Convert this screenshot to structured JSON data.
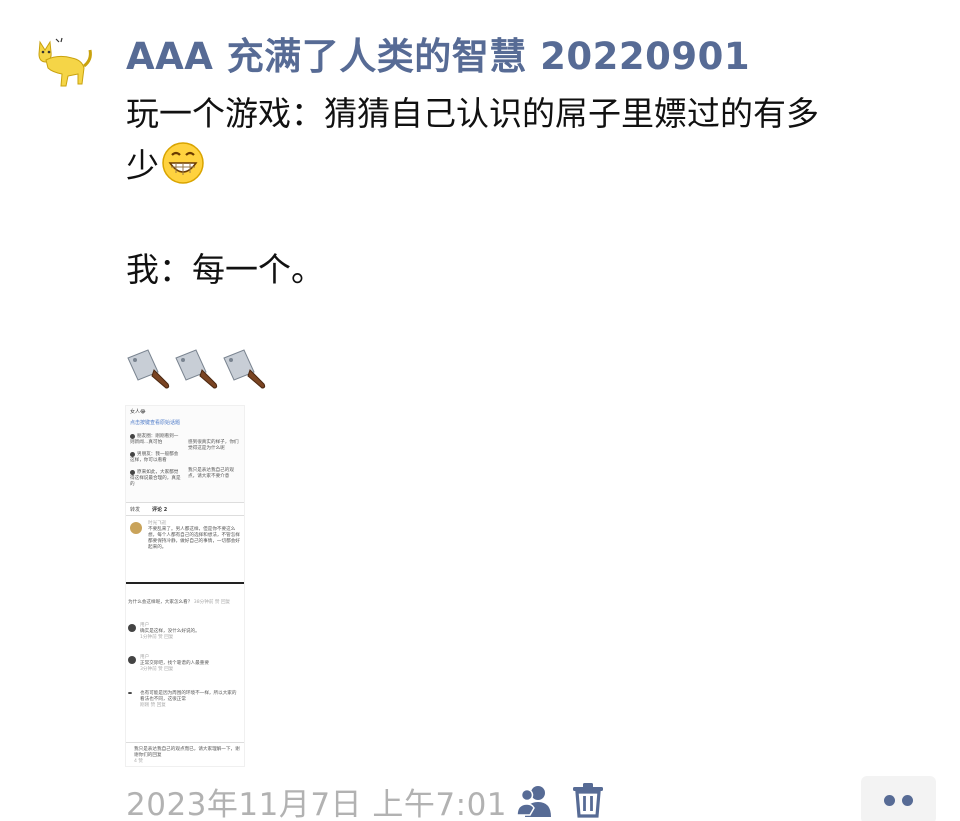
{
  "post": {
    "author": "AAA 充满了人类的智慧 20220901",
    "lines": [
      "玩一个游戏：猜猜自己认识的屌子里嫖过的有多",
      "少",
      "我：每一个。"
    ],
    "emoji_icons": [
      "grinning-face-icon",
      "cleaver-icon",
      "cleaver-icon",
      "cleaver-icon"
    ]
  },
  "thumbnail": {
    "head_title": "女人😂",
    "head_link": "点击按键查看原始话题",
    "bubble_left_1": "朋友圈：刚刚看到一则新闻…真可怕",
    "bubble_left_2": "男朋友：我一般都会这样，你可以看看",
    "bubble_left_3": "原来如此，大家都觉得这样说最合理的，真是的",
    "bubble_right_1": "感到很真实的样子，你们觉得这是为什么呢",
    "bubble_right_2": "我只是表达我自己的观点，请大家不要介意",
    "tab_1": "转发",
    "tab_2": "评论 2",
    "comment_name": "时光飞逝",
    "comment_text": "不要乱来了。男人都这样，但是你不要这么想，每个人都有自己的选择和想法，不管怎样都要保持冷静，做好自己的事情，一切都会好起来的。",
    "question": "为什么会这样呢，大家怎么看？",
    "question_meta": "38分钟前 赞 回复",
    "reply_1_name": "用户",
    "reply_1_text": "确实是这样，没什么好说的。",
    "reply_1_meta": "1分钟前 赞 回复",
    "reply_2_name": "用户",
    "reply_2_text": "正常交际吧，找个靠谱的人最重要",
    "reply_2_meta": "3分钟前 赞 回复",
    "reply_3_text": "也有可能是因为周围的环境不一样，所以大家的看法也不同，这很正常",
    "reply_3_meta": "刚刚 赞 回复",
    "bottom_text": "我只是表达我自己的观点而已，请大家理解一下，谢谢你们的回复",
    "bottom_meta": "4 赞"
  },
  "footer": {
    "timestamp": "2023年11月7日 上午7:01",
    "visibility_icon": "people-icon",
    "delete_icon": "trash-icon",
    "more_icon": "more-dots-icon"
  },
  "colors": {
    "author": "#576b95",
    "text": "#111111",
    "timestamp": "#b2b2b2",
    "more_bg": "#f3f3f3"
  }
}
